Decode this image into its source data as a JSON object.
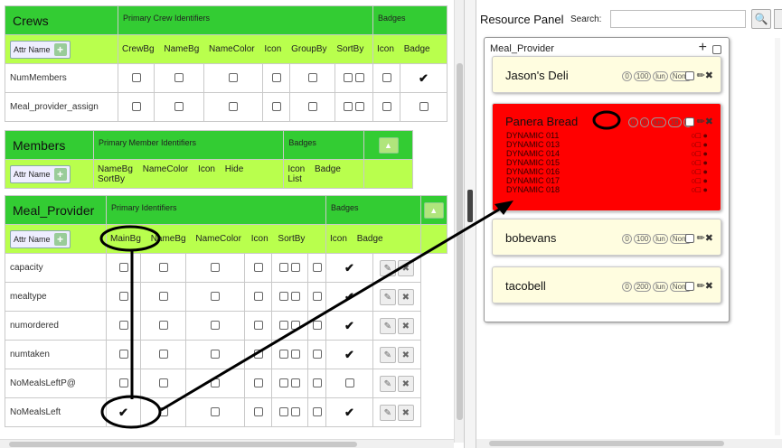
{
  "crews": {
    "title": "Crews",
    "group_primary": "Primary Crew Identifiers",
    "group_badges": "Badges",
    "attr_name": "Attr Name",
    "columns": [
      "CrewBg",
      "NameBg",
      "NameColor",
      "Icon",
      "GroupBy",
      "SortBy",
      "Icon",
      "Badge"
    ],
    "rows": [
      {
        "name": "NumMembers"
      },
      {
        "name": "Meal_provider_assign"
      }
    ]
  },
  "members": {
    "title": "Members",
    "group_primary": "Primary Member Identifiers",
    "group_badges": "Badges",
    "attr_name": "Attr Name",
    "columns": [
      "NameBg",
      "NameColor",
      "Icon",
      "Hide",
      "SortBy",
      "Icon",
      "Badge",
      "List"
    ]
  },
  "meal_provider": {
    "title": "Meal_Provider",
    "group_primary": "Primary Identifiers",
    "group_badges": "Badges",
    "attr_name": "Attr Name",
    "columns": [
      "MainBg",
      "NameBg",
      "NameColor",
      "Icon",
      "SortBy",
      "Icon",
      "Badge"
    ],
    "rows": [
      {
        "name": "capacity"
      },
      {
        "name": "mealtype"
      },
      {
        "name": "numordered"
      },
      {
        "name": "numtaken"
      },
      {
        "name": "NoMealsLeftP@"
      },
      {
        "name": "NoMealsLeft"
      }
    ]
  },
  "resource_panel": {
    "title": "Resource Panel",
    "search_label": "Search:",
    "search_value": "",
    "group_name": "Meal_Provider",
    "cards": [
      {
        "name": "Jason's Deli",
        "pills": [
          "0",
          "100",
          "lun",
          "None"
        ]
      },
      {
        "name": "Panera Bread",
        "pills": [
          "0",
          "0",
          "lun",
          "18",
          "0"
        ]
      },
      {
        "name": "bobevans",
        "pills": [
          "0",
          "100",
          "lun",
          "None"
        ]
      },
      {
        "name": "tacobell",
        "pills": [
          "0",
          "200",
          "lun",
          "None"
        ]
      }
    ],
    "dynamic_items": [
      "DYNAMIC 011",
      "DYNAMIC 013",
      "DYNAMIC 014",
      "DYNAMIC 015",
      "DYNAMIC 016",
      "DYNAMIC 017",
      "DYNAMIC 018"
    ]
  },
  "colors": {
    "header_green": "#33cc33",
    "sub_green": "#b9ff4d",
    "card_yellow": "#fffde0",
    "highlight_red": "#ff0000"
  }
}
